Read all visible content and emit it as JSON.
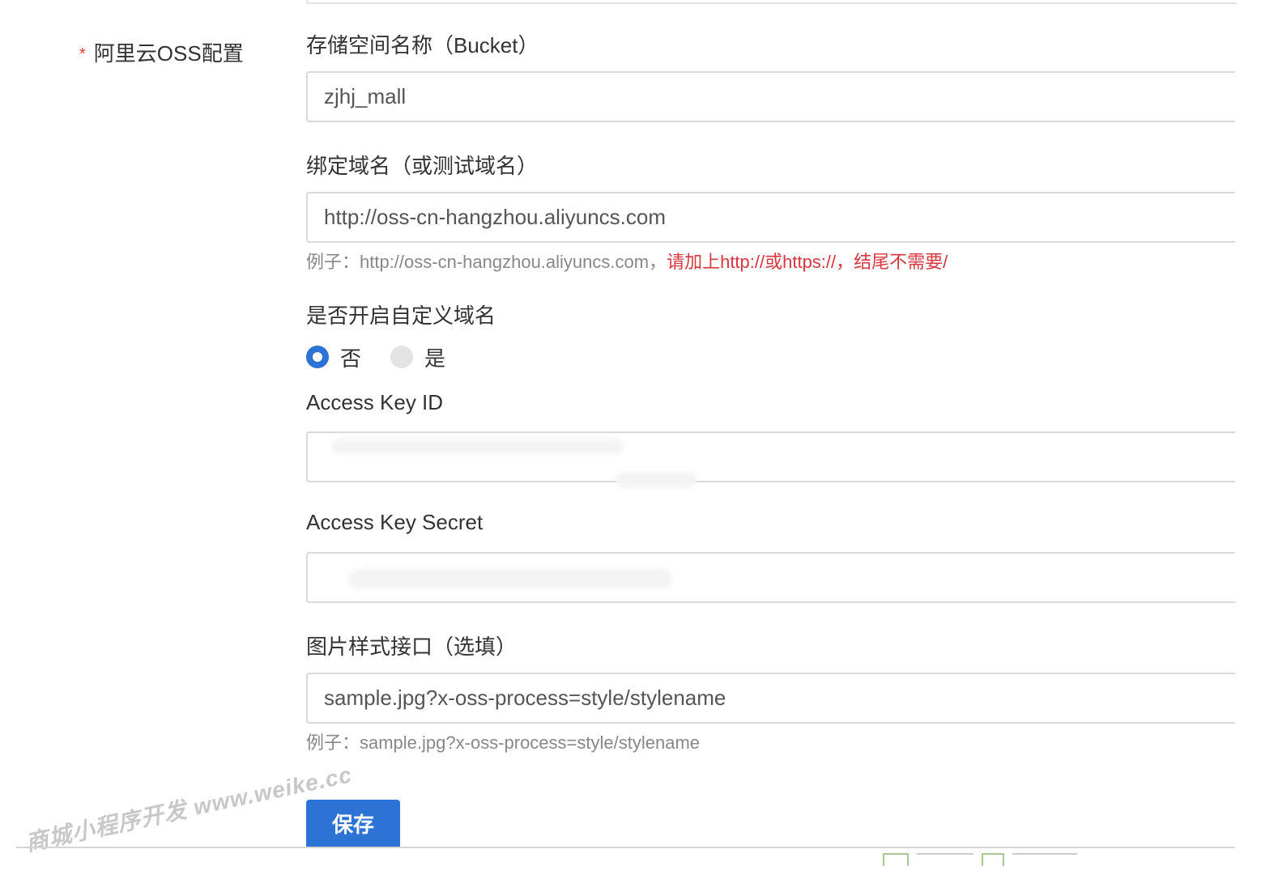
{
  "section": {
    "required_mark": "*",
    "label": "阿里云OSS配置"
  },
  "bucket": {
    "label": "存储空间名称（Bucket）",
    "value": "zjhj_mall"
  },
  "domain": {
    "label": "绑定域名（或测试域名）",
    "value": "http://oss-cn-hangzhou.aliyuncs.com",
    "help_example": "例子：http://oss-cn-hangzhou.aliyuncs.com，",
    "help_warning": "请加上http://或https://，结尾不需要/"
  },
  "custom_domain": {
    "label": "是否开启自定义域名",
    "options": [
      {
        "label": "否",
        "selected": true
      },
      {
        "label": "是",
        "selected": false
      }
    ]
  },
  "access_key_id": {
    "label": "Access Key ID",
    "value": ""
  },
  "access_key_secret": {
    "label": "Access Key Secret",
    "value": ""
  },
  "image_style": {
    "label": "图片样式接口（选填）",
    "value": "sample.jpg?x-oss-process=style/stylename",
    "help_example": "例子：sample.jpg?x-oss-process=style/stylename"
  },
  "save_button": {
    "label": "保存"
  },
  "watermark": "商城小程序开发  www.weike.cc",
  "colors": {
    "primary": "#2d73d6",
    "required": "#e4393c",
    "warning": "#d9363e"
  }
}
